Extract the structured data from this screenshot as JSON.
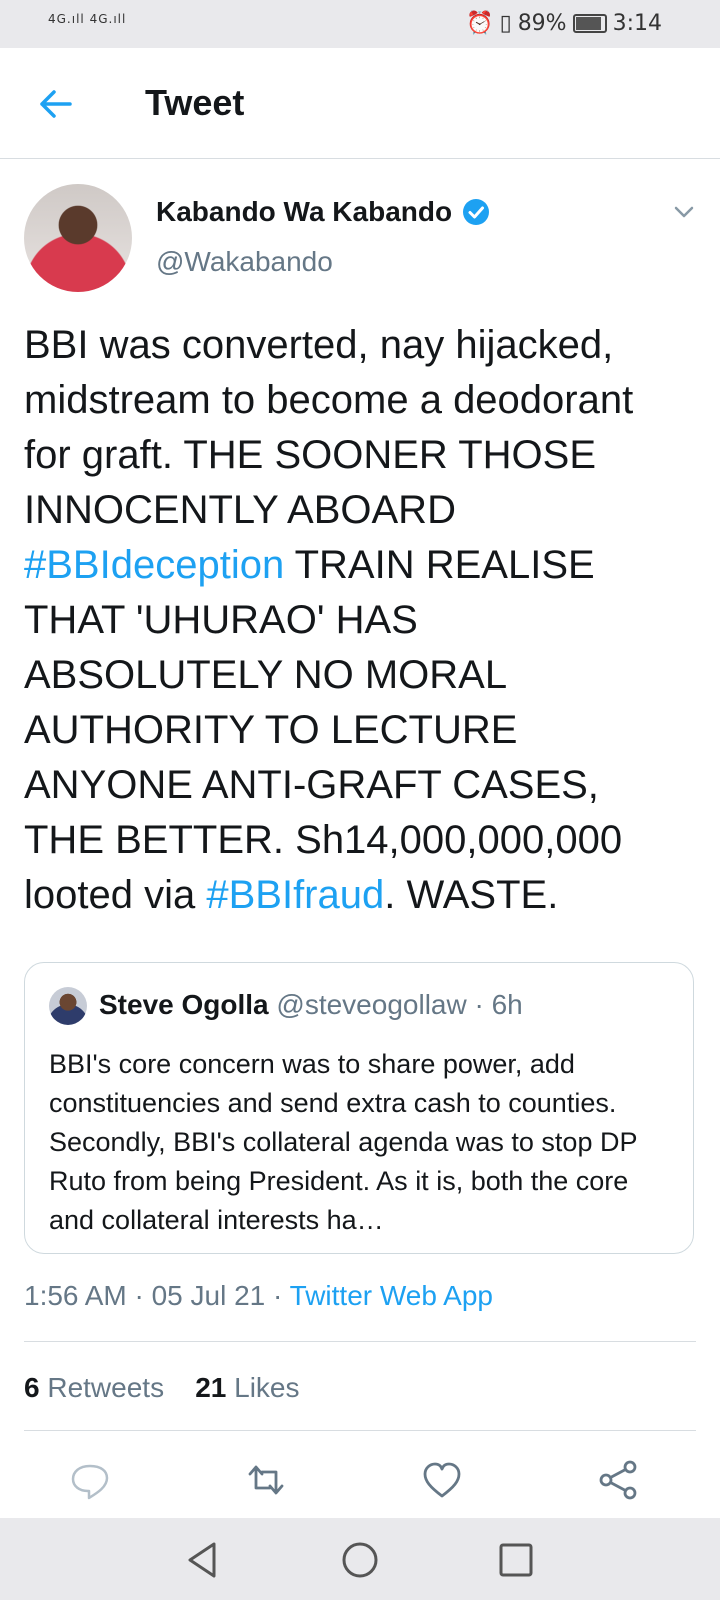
{
  "status_bar": {
    "signal_left": "4G.ıll 4G.ıll",
    "battery_percent": "89%",
    "time": "3:14"
  },
  "header": {
    "title": "Tweet"
  },
  "tweet": {
    "author_name": "Kabando Wa Kabando",
    "author_handle": "@Wakabando",
    "text_part1": "BBI was converted, nay hijacked, midstream to become a deodorant for graft. THE SOONER THOSE INNOCENTLY ABOARD ",
    "hashtag1": "#BBIdeception",
    "text_part2": " TRAIN REALISE THAT 'UHURAO' HAS ABSOLUTELY NO MORAL AUTHORITY TO LECTURE ANYONE ANTI-GRAFT CASES, THE BETTER. Sh14,000,000,000 looted via ",
    "hashtag2": "#BBIfraud",
    "text_part3": ". WASTE."
  },
  "quoted_tweet": {
    "author_name": "Steve Ogolla",
    "author_handle": "@steveogollaw",
    "age": "· 6h",
    "text": "BBI's core concern was to share power, add constituencies and send extra cash to counties. Secondly, BBI's collateral agenda was to stop DP Ruto from being President. As it is, both the core and collateral interests ha…"
  },
  "meta": {
    "time_date": "1:56 AM · 05 Jul 21 · ",
    "source": "Twitter Web App"
  },
  "stats": {
    "retweets_count": "6",
    "retweets_label": "Retweets",
    "likes_count": "21",
    "likes_label": "Likes"
  },
  "colors": {
    "accent": "#1da1f2",
    "secondary_text": "#657786",
    "primary_text": "#14171a"
  },
  "icons": [
    "back-arrow-icon",
    "verified-badge-icon",
    "chevron-down-icon",
    "reply-icon",
    "retweet-icon",
    "like-icon",
    "share-icon",
    "nav-back-icon",
    "nav-home-icon",
    "nav-recents-icon"
  ]
}
